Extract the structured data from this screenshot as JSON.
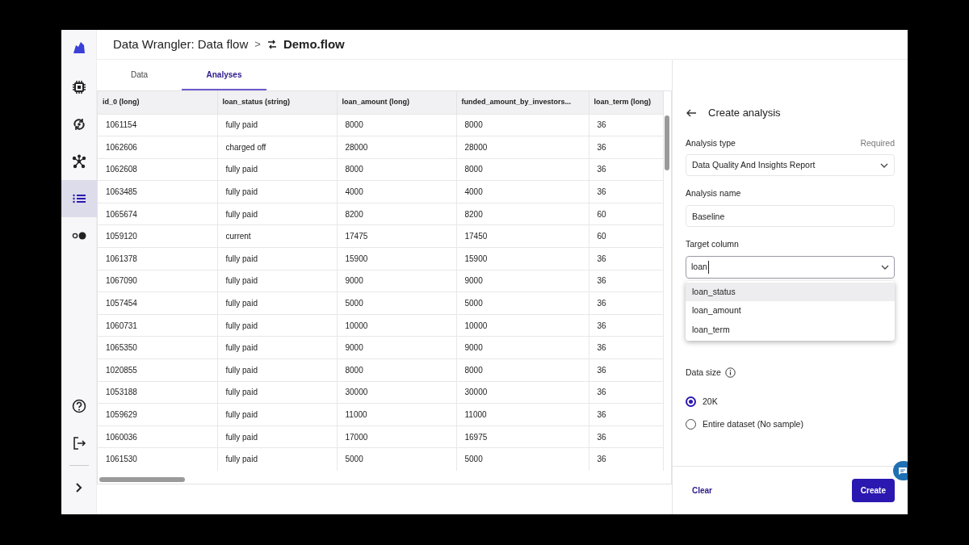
{
  "header": {
    "app_title": "Data Wrangler: Data flow",
    "separator": ">",
    "file_name": "Demo.flow"
  },
  "sidebar": {
    "items": [
      {
        "kind": "chip",
        "selected": false
      },
      {
        "kind": "cycle",
        "selected": false
      },
      {
        "kind": "nodes",
        "selected": false
      },
      {
        "kind": "list",
        "selected": true
      },
      {
        "kind": "dots",
        "selected": false
      }
    ],
    "bottom_items": [
      {
        "kind": "help"
      },
      {
        "kind": "exit"
      },
      {
        "kind": "expand"
      }
    ]
  },
  "tabs": [
    {
      "label": "Data",
      "selected": false
    },
    {
      "label": "Analyses",
      "selected": true
    }
  ],
  "table": {
    "columns": [
      "id_0 (long)",
      "loan_status (string)",
      "loan_amount (long)",
      "funded_amount_by_investors...",
      "loan_term (long)"
    ],
    "rows": [
      [
        "1061154",
        "fully paid",
        "8000",
        "8000",
        "36"
      ],
      [
        "1062606",
        "charged off",
        "28000",
        "28000",
        "36"
      ],
      [
        "1062608",
        "fully paid",
        "8000",
        "8000",
        "36"
      ],
      [
        "1063485",
        "fully paid",
        "4000",
        "4000",
        "36"
      ],
      [
        "1065674",
        "fully paid",
        "8200",
        "8200",
        "60"
      ],
      [
        "1059120",
        "current",
        "17475",
        "17450",
        "60"
      ],
      [
        "1061378",
        "fully paid",
        "15900",
        "15900",
        "36"
      ],
      [
        "1067090",
        "fully paid",
        "9000",
        "9000",
        "36"
      ],
      [
        "1057454",
        "fully paid",
        "5000",
        "5000",
        "36"
      ],
      [
        "1060731",
        "fully paid",
        "10000",
        "10000",
        "36"
      ],
      [
        "1065350",
        "fully paid",
        "9000",
        "9000",
        "36"
      ],
      [
        "1020855",
        "fully paid",
        "8000",
        "8000",
        "36"
      ],
      [
        "1053188",
        "fully paid",
        "30000",
        "30000",
        "36"
      ],
      [
        "1059629",
        "fully paid",
        "11000",
        "11000",
        "36"
      ],
      [
        "1060036",
        "fully paid",
        "17000",
        "16975",
        "36"
      ],
      [
        "1061530",
        "fully paid",
        "5000",
        "5000",
        "36"
      ]
    ]
  },
  "panel": {
    "title": "Create analysis",
    "analysis_type": {
      "label": "Analysis type",
      "required": "Required",
      "value": "Data Quality And Insights Report"
    },
    "analysis_name": {
      "label": "Analysis name",
      "value": "Baseline"
    },
    "target_column": {
      "label": "Target column",
      "value": "loan",
      "options": [
        {
          "label": "loan_status",
          "selected": true
        },
        {
          "label": "loan_amount",
          "selected": false
        },
        {
          "label": "loan_term",
          "selected": false
        }
      ]
    },
    "data_size": {
      "label": "Data size",
      "options": [
        {
          "label": "20K",
          "selected": true
        },
        {
          "label": "Entire dataset (No sample)",
          "selected": false
        }
      ]
    },
    "buttons": {
      "clear": "Clear",
      "create": "Create"
    }
  }
}
